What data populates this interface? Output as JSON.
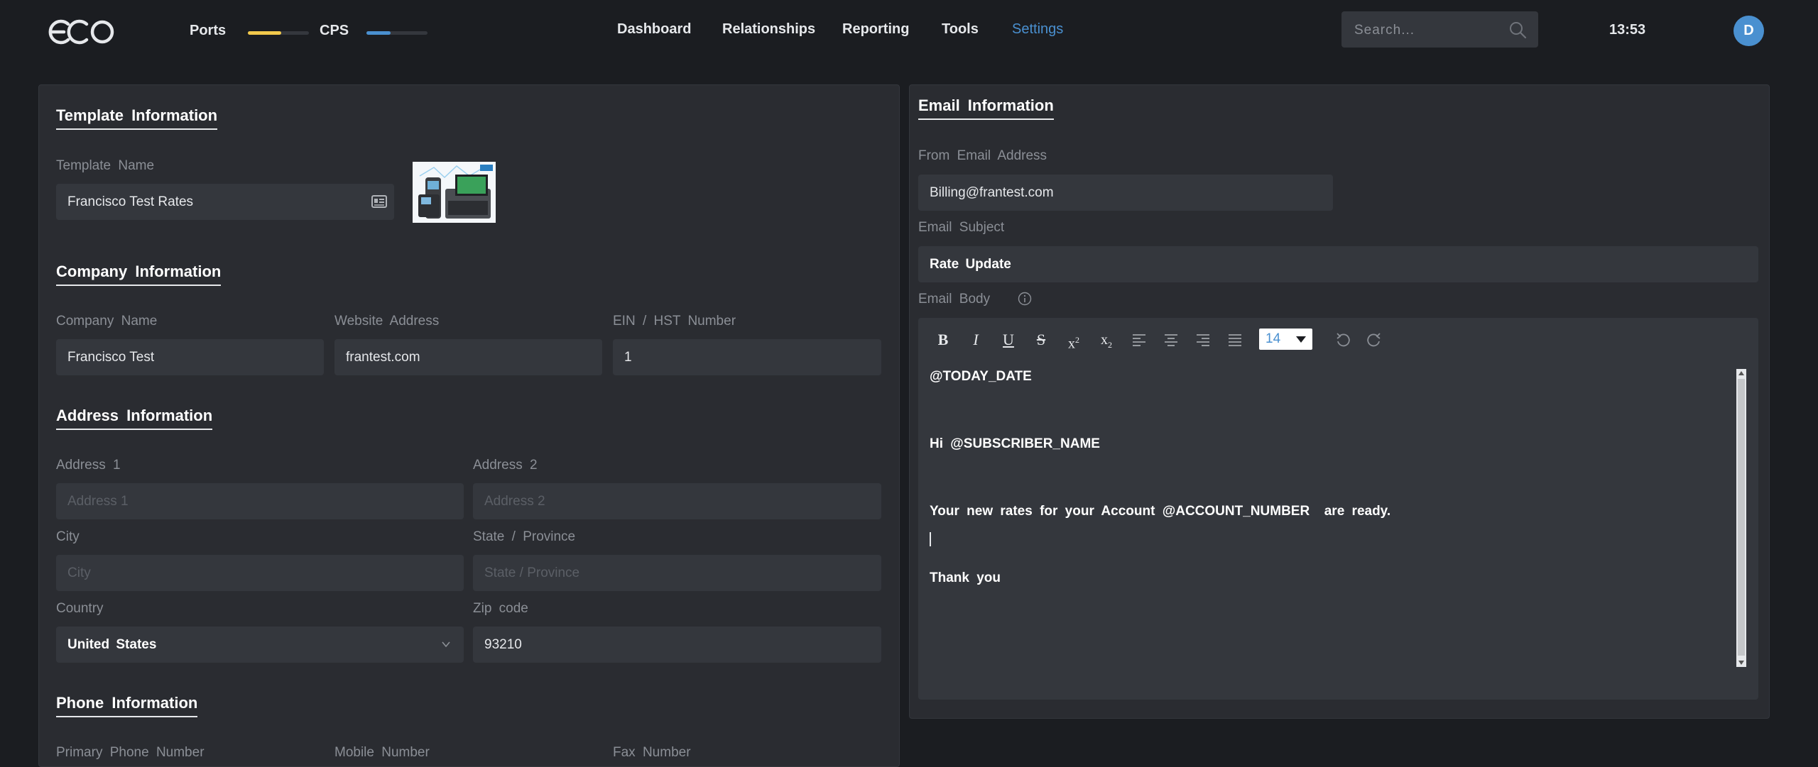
{
  "topbar": {
    "logo_text": "eco",
    "ports": {
      "label": "Ports",
      "level": 0.55,
      "color": "#f2c94c"
    },
    "cps": {
      "label": "CPS",
      "level": 0.4,
      "color": "#4a90d0"
    },
    "nav": [
      {
        "label": "Dashboard",
        "active": false
      },
      {
        "label": "Relationships",
        "active": false
      },
      {
        "label": "Reporting",
        "active": false
      },
      {
        "label": "Tools",
        "active": false
      },
      {
        "label": "Settings",
        "active": true
      }
    ],
    "search_placeholder": "Search...",
    "clock": "13:53",
    "avatar_initial": "D"
  },
  "template_info": {
    "title": "Template Information",
    "template_name_label": "Template Name",
    "template_name_value": "Francisco Test Rates",
    "template_name_icon": "id-card-icon"
  },
  "company_info": {
    "title": "Company Information",
    "company_name_label": "Company Name",
    "company_name_value": "Francisco Test",
    "website_label": "Website Address",
    "website_value": "frantest.com",
    "ein_label": "EIN / HST Number",
    "ein_value": "1"
  },
  "address_info": {
    "title": "Address Information",
    "address1_label": "Address 1",
    "address1_placeholder": "Address 1",
    "address2_label": "Address 2",
    "address2_placeholder": "Address 2",
    "city_label": "City",
    "city_placeholder": "City",
    "state_label": "State / Province",
    "state_placeholder": "State / Province",
    "country_label": "Country",
    "country_value": "United States",
    "zip_label": "Zip code",
    "zip_value": "93210"
  },
  "phone_info": {
    "title": "Phone Information",
    "primary_label": "Primary Phone Number",
    "mobile_label": "Mobile Number",
    "fax_label": "Fax Number"
  },
  "email_info": {
    "title": "Email Information",
    "from_label": "From Email Address",
    "from_value": "Billing@frantest.com",
    "subject_label": "Email Subject",
    "subject_value": "Rate Update",
    "body_label": "Email Body",
    "font_size": "14",
    "body_lines": [
      "@TODAY_DATE",
      "Hi @SUBSCRIBER_NAME",
      "Your new rates for your Account @ACCOUNT_NUMBER  are ready.",
      "Thank you"
    ]
  },
  "colors": {
    "background": "#1b1d21",
    "panel": "#2a2c31",
    "field": "#34373d",
    "accent": "#4a90d0",
    "ports_meter": "#f2c94c"
  }
}
